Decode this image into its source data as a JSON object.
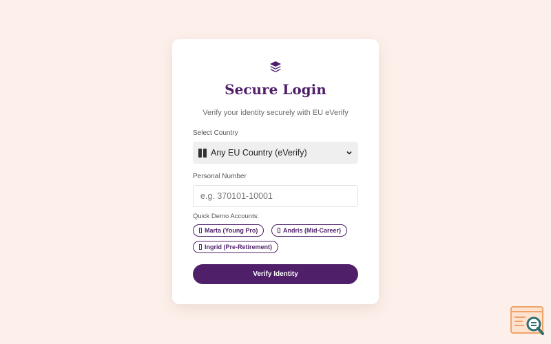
{
  "colors": {
    "background": "#fdf0ea",
    "brand": "#4f1f6a",
    "card": "#ffffff",
    "select_bg": "#efefef",
    "widget_orange": "#f0a36a",
    "widget_teal": "#2e6e6e"
  },
  "header": {
    "logo_icon": "layers-icon",
    "title": "Secure Login",
    "subtitle": "Verify your identity securely with EU eVerify"
  },
  "country": {
    "label": "Select Country",
    "selected": "Any EU Country (eVerify)",
    "flag_icon": "flag-icon",
    "chevron_icon": "chevron-down-icon"
  },
  "personal_number": {
    "label": "Personal Number",
    "value": "",
    "placeholder": "e.g. 370101-10001"
  },
  "demo": {
    "label": "Quick Demo Accounts:",
    "accounts": [
      {
        "label": "Marta (Young Pro)",
        "icon": "user-icon"
      },
      {
        "label": "Andris (Mid-Career)",
        "icon": "user-icon"
      },
      {
        "label": "Ingrid (Pre-Retirement)",
        "icon": "user-icon"
      }
    ]
  },
  "actions": {
    "verify_label": "Verify Identity"
  },
  "widget": {
    "icon": "search-document-icon"
  }
}
